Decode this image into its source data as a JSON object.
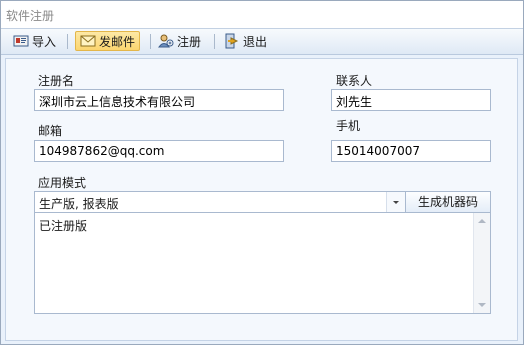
{
  "window": {
    "title": "软件注册"
  },
  "toolbar": {
    "import_label": "导入",
    "send_mail_label": "发邮件",
    "register_label": "注册",
    "exit_label": "退出"
  },
  "form": {
    "reg_name_label": "注册名",
    "reg_name_value": "深圳市云上信息技术有限公司",
    "contact_label": "联系人",
    "contact_value": "刘先生",
    "email_label": "邮箱",
    "email_value": "104987862@qq.com",
    "phone_label": "手机",
    "phone_value": "15014007007",
    "app_mode_label": "应用模式",
    "app_mode_value": "生产版, 报表版",
    "generate_button": "生成机器码",
    "status_text": "已注册版"
  },
  "icons": {
    "import": "import-icon",
    "send_mail": "mail-icon",
    "register": "register-icon",
    "exit": "exit-icon"
  },
  "colors": {
    "active_button": "#fbd56f",
    "panel_bg": "#f4f8fd",
    "border": "#a9b9cf"
  }
}
